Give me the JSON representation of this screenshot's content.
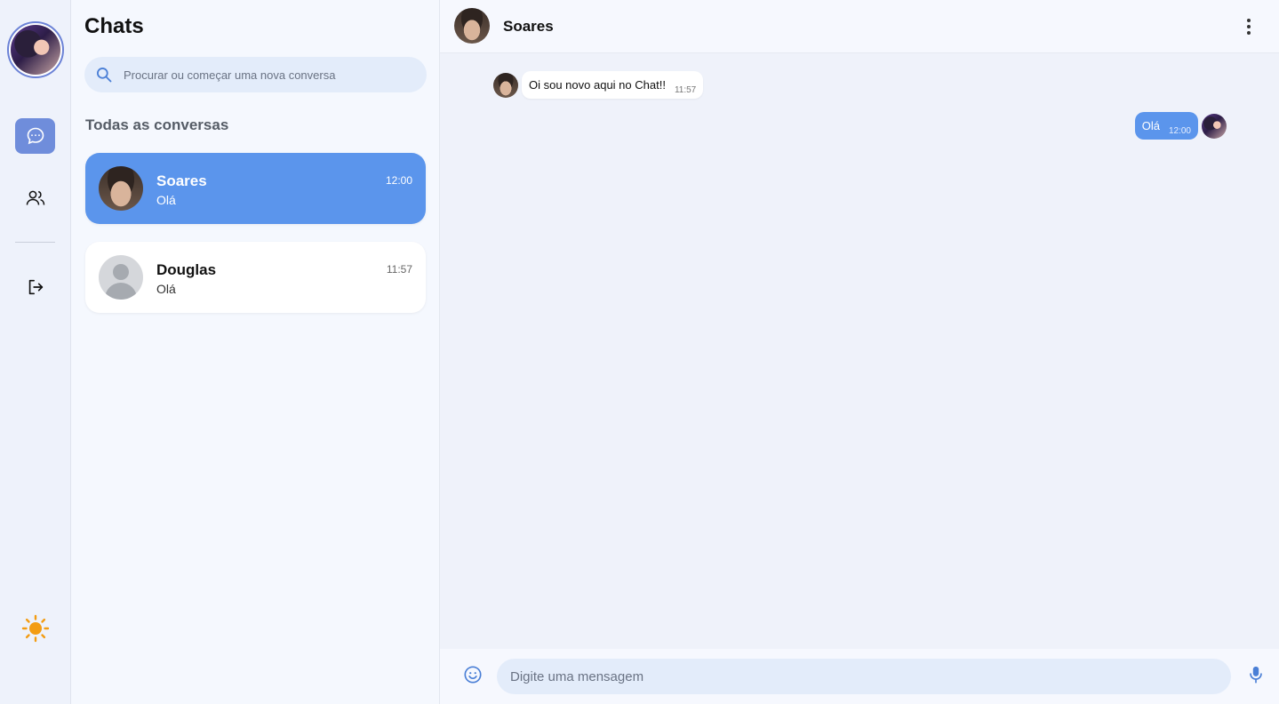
{
  "rail": {
    "icons": [
      "chat-bubble-icon",
      "users-icon",
      "logout-icon",
      "sun-icon"
    ],
    "accent": "#6f8ddb",
    "theme_icon_color": "#f39c12"
  },
  "sidebar": {
    "title": "Chats",
    "search": {
      "placeholder": "Procurar ou começar uma nova conversa",
      "value": ""
    },
    "section_label": "Todas as conversas",
    "conversations": [
      {
        "name": "Soares",
        "preview": "Olá",
        "time": "12:00",
        "active": true
      },
      {
        "name": "Douglas",
        "preview": "Olá",
        "time": "11:57",
        "active": false
      }
    ]
  },
  "chat": {
    "contact_name": "Soares",
    "messages": [
      {
        "direction": "incoming",
        "text": "Oi sou novo aqui no Chat!!",
        "time": "11:57"
      },
      {
        "direction": "outgoing",
        "text": "Olá",
        "time": "12:00"
      }
    ],
    "composer": {
      "placeholder": "Digite uma mensagem",
      "value": ""
    }
  },
  "colors": {
    "active_card": "#5b95ec",
    "outgoing_bubble": "#5b95ec",
    "search_bg": "#e3ecfa"
  }
}
